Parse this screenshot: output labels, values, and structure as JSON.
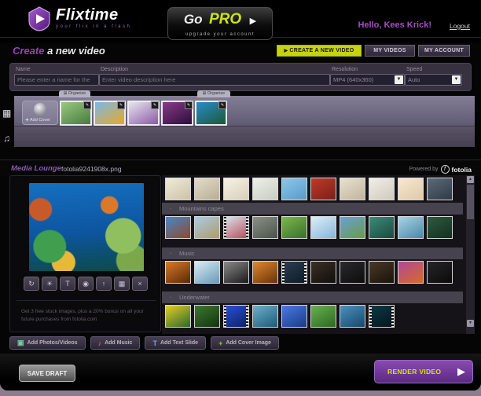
{
  "header": {
    "brand": "Flixtime",
    "tagline": "your flix in a flash",
    "gopro_word1": "Go",
    "gopro_word2": "PRO",
    "gopro_arrow": "▶",
    "gopro_sub": "upgrade your account",
    "greeting": "Hello, Kees Krick!",
    "logout": "Logout"
  },
  "nav": {
    "title_accent": "Create",
    "title_rest": " a new video",
    "create_arrow": "▶",
    "create_label": "CREATE A NEW VIDEO",
    "videos_label": "MY VIDEOS",
    "account_label": "MY ACCOUNT"
  },
  "form": {
    "name_label": "Name",
    "name_placeholder": "Please enter a name for the",
    "desc_label": "Description",
    "desc_placeholder": "Enter video description here",
    "resolution_label": "Resolution",
    "resolution_value": "MP4 (640x360)",
    "speed_label": "Speed",
    "speed_value": "Auto",
    "dropdown_glyph": "▼"
  },
  "timeline": {
    "film_track_icon_glyph": "▦",
    "audio_track_icon_glyph": "♫",
    "organize_left": "⊞ Organize",
    "organize_right": "⊞ Organize",
    "add_cover_plus": "+",
    "add_cover_label": "Add Cover",
    "edit_badge_glyph": "✎",
    "clips": [
      {
        "name": "hands-flower-clip",
        "c1": "#98c880",
        "c2": "#4a7a3e"
      },
      {
        "name": "sunflower-sky-clip",
        "c1": "#7ab8e8",
        "c2": "#e8a828"
      },
      {
        "name": "lavender-field-clip",
        "c1": "#e8e4ee",
        "c2": "#8a5aa8"
      },
      {
        "name": "purple-flowers-clip",
        "c1": "#8a3a88",
        "c2": "#2a0e3a"
      },
      {
        "name": "coral-reef-clip",
        "c1": "#2a8ac8",
        "c2": "#1a5a38"
      }
    ]
  },
  "media_lounge": {
    "title": "Media Lounge",
    "filename": "fotolia9241908x.png",
    "powered_by": "Powered by",
    "provider_initial": "f",
    "provider": "fotolia"
  },
  "preview": {
    "toolbar": [
      {
        "name": "rotate-icon",
        "glyph": "↻"
      },
      {
        "name": "brightness-icon",
        "glyph": "☀"
      },
      {
        "name": "text-icon",
        "glyph": "T"
      },
      {
        "name": "camera-icon",
        "glyph": "◉"
      },
      {
        "name": "upload-icon",
        "glyph": "↑"
      },
      {
        "name": "save-icon",
        "glyph": "▦"
      },
      {
        "name": "delete-icon",
        "glyph": "×"
      }
    ],
    "promo": "Get 3 free stock images, plus a 20% bonus on all your future purchases from fotolia.com"
  },
  "browser": {
    "collapse_arrow_glyph": "▪",
    "scroll_up_glyph": "▲",
    "scroll_down_glyph": "▼",
    "rows": [
      {
        "header": null,
        "thumbs": [
          {
            "c1": "#f0ead8",
            "c2": "#cbc2a8"
          },
          {
            "c1": "#e4dcc8",
            "c2": "#b8ae96"
          },
          {
            "c1": "#f6f2e6",
            "c2": "#d8cfb8"
          },
          {
            "c1": "#eef0ea",
            "c2": "#c8ccc0"
          },
          {
            "c1": "#8ec6ea",
            "c2": "#5a9ac8"
          },
          {
            "c1": "#c0392b",
            "c2": "#7a1f16"
          },
          {
            "c1": "#e8e0d0",
            "c2": "#c0b49c"
          },
          {
            "c1": "#f0eee8",
            "c2": "#d0cabc"
          },
          {
            "c1": "#f6e8d2",
            "c2": "#e0c9a8"
          },
          {
            "c1": "#5c6a78",
            "c2": "#2e3a46"
          }
        ]
      },
      {
        "header": "Mountains capes",
        "thumbs": [
          {
            "c1": "#4a86c8",
            "c2": "#8a4a2e"
          },
          {
            "c1": "#a8cce6",
            "c2": "#b09a6a"
          },
          {
            "c1": "#d8e8f0",
            "c2": "#b84a5a",
            "film": true
          },
          {
            "c1": "#8a9288",
            "c2": "#4a524a"
          },
          {
            "c1": "#7ab84e",
            "c2": "#3c6e2a"
          },
          {
            "c1": "#dceef8",
            "c2": "#88b4d8"
          },
          {
            "c1": "#6aa0d8",
            "c2": "#6a9a4a"
          },
          {
            "c1": "#3e8a7a",
            "c2": "#1c4a3e"
          },
          {
            "c1": "#a8d4e4",
            "c2": "#4a88a8"
          },
          {
            "c1": "#2e5a40",
            "c2": "#12301e"
          }
        ]
      },
      {
        "header": "Music",
        "thumbs": [
          {
            "c1": "#d87a28",
            "c2": "#5a2808"
          },
          {
            "c1": "#d8ecf4",
            "c2": "#6a9ab8"
          },
          {
            "c1": "#8a8a8a",
            "c2": "#1a1a1a"
          },
          {
            "c1": "#e08830",
            "c2": "#6a3208"
          },
          {
            "c1": "#2a3e52",
            "c2": "#0e1a26",
            "film": true
          },
          {
            "c1": "#3a3026",
            "c2": "#120e0a"
          },
          {
            "c1": "#2a2a2e",
            "c2": "#0c0c0e"
          },
          {
            "c1": "#4a3828",
            "c2": "#1a120a"
          },
          {
            "c1": "#b04898",
            "c2": "#d86a28"
          },
          {
            "c1": "#26262a",
            "c2": "#0a0a0c"
          }
        ]
      },
      {
        "header": "Underwater",
        "thumbs": [
          {
            "c1": "#e8cc28",
            "c2": "#2a6a2a"
          },
          {
            "c1": "#3a7a2e",
            "c2": "#14320f"
          },
          {
            "c1": "#2a52d8",
            "c2": "#0c1e6a",
            "film": true
          },
          {
            "c1": "#6ab2cc",
            "c2": "#1e5a78"
          },
          {
            "c1": "#4a7ae0",
            "c2": "#1a3a8a"
          },
          {
            "c1": "#6ab050",
            "c2": "#2a6a1e"
          },
          {
            "c1": "#4a92c0",
            "c2": "#16486a"
          },
          {
            "c1": "#0e3a48",
            "c2": "#04141c",
            "film": true
          }
        ]
      }
    ]
  },
  "footer": {
    "add_buttons": [
      {
        "name": "add-photos-videos-button",
        "icon": "photo-icon",
        "glyph": "▣",
        "color": "#7ec8a0",
        "label": "Add Photos/Videos"
      },
      {
        "name": "add-music-button",
        "icon": "music-note-icon",
        "glyph": "♪",
        "color": "#e070a8",
        "label": "Add Music"
      },
      {
        "name": "add-text-slide-button",
        "icon": "text-slide-icon",
        "glyph": "T",
        "color": "#7a9ae0",
        "label": "Add Text Slide"
      },
      {
        "name": "add-cover-image-button",
        "icon": "cover-plus-icon",
        "glyph": "+",
        "color": "#90c838",
        "label": "Add Cover Image"
      }
    ],
    "save_draft": "SAVE DRAFT",
    "render_video": "RENDER VIDEO",
    "render_arrow": "▶"
  }
}
